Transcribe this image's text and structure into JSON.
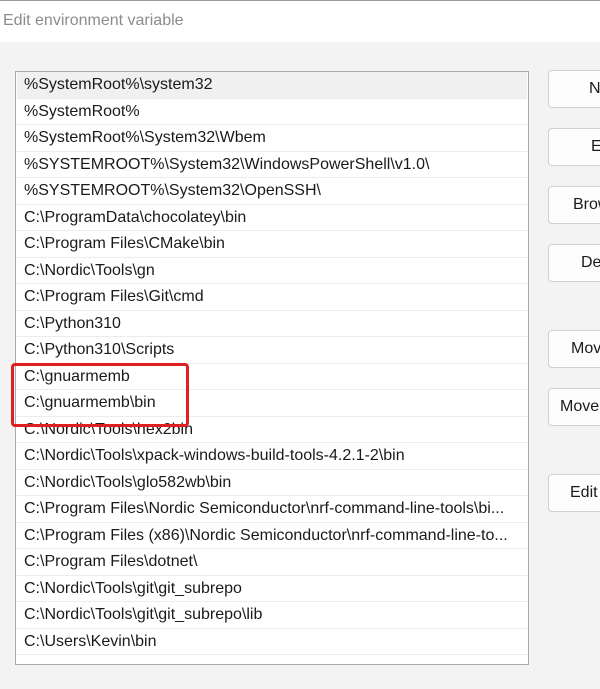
{
  "window": {
    "title": "Edit environment variable"
  },
  "path_list": {
    "items": [
      "%SystemRoot%\\system32",
      "%SystemRoot%",
      "%SystemRoot%\\System32\\Wbem",
      "%SYSTEMROOT%\\System32\\WindowsPowerShell\\v1.0\\",
      "%SYSTEMROOT%\\System32\\OpenSSH\\",
      "C:\\ProgramData\\chocolatey\\bin",
      "C:\\Program Files\\CMake\\bin",
      "C:\\Nordic\\Tools\\gn",
      "C:\\Program Files\\Git\\cmd",
      "C:\\Python310",
      "C:\\Python310\\Scripts",
      "C:\\gnuarmemb",
      "C:\\gnuarmemb\\bin",
      "C:\\Nordic\\Tools\\hex2bin",
      "C:\\Nordic\\Tools\\xpack-windows-build-tools-4.2.1-2\\bin",
      "C:\\Nordic\\Tools\\glo582wb\\bin",
      "C:\\Program Files\\Nordic Semiconductor\\nrf-command-line-tools\\bi...",
      "C:\\Program Files (x86)\\Nordic Semiconductor\\nrf-command-line-to...",
      "C:\\Program Files\\dotnet\\",
      "C:\\Nordic\\Tools\\git\\git_subrepo",
      "C:\\Nordic\\Tools\\git\\git_subrepo\\lib",
      "C:\\Users\\Kevin\\bin"
    ],
    "selected_index": 0,
    "highlighted_items": [
      11,
      12
    ]
  },
  "buttons": {
    "new": "N",
    "edit": "Ed",
    "browse": "Brow",
    "delete": "De",
    "move_up": "Mov",
    "move_down": "Move",
    "edit_text": "Edit"
  },
  "colors": {
    "highlight_box": "#e02020",
    "selected_row": "#f0f0f0"
  }
}
